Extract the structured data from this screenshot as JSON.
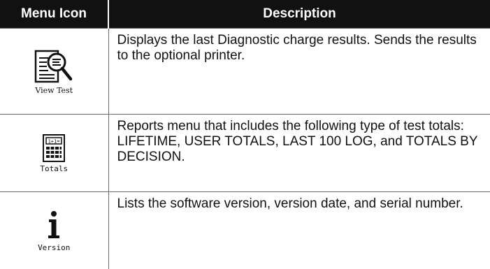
{
  "header": {
    "col_icon": "Menu Icon",
    "col_description": "Description"
  },
  "rows": [
    {
      "icon_name": "view-test-icon",
      "icon_label": "View Test",
      "description": "Displays the last Diagnostic charge results. Sends the results to the optional printer."
    },
    {
      "icon_name": "totals-icon",
      "icon_label": "Totals",
      "description": "Reports menu that includes the following type of test totals: LIFETIME, USER TOTALS, LAST 100 LOG, and TOTALS BY DECISION."
    },
    {
      "icon_name": "version-icon",
      "icon_label": "Version",
      "description": "Lists the software version, version date, and serial number."
    }
  ]
}
